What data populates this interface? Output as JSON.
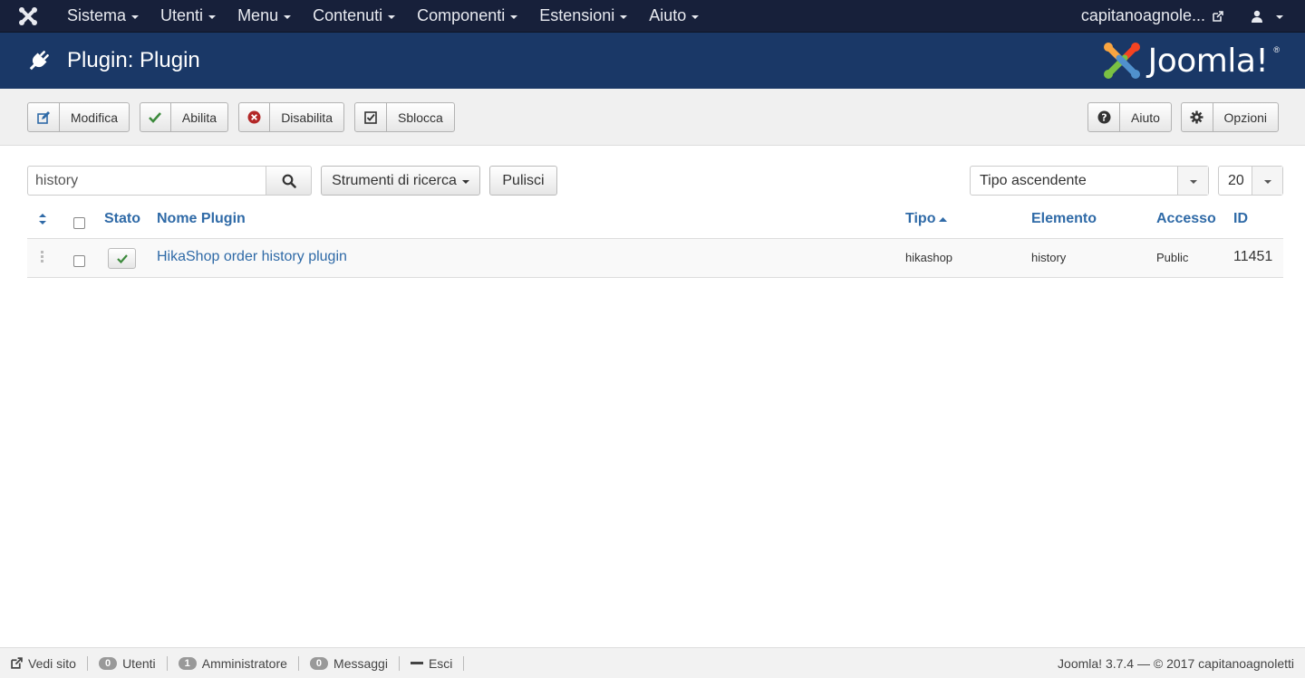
{
  "navbar": {
    "menus": [
      {
        "label": "Sistema"
      },
      {
        "label": "Utenti"
      },
      {
        "label": "Menu"
      },
      {
        "label": "Contenuti"
      },
      {
        "label": "Componenti"
      },
      {
        "label": "Estensioni"
      },
      {
        "label": "Aiuto"
      }
    ],
    "site_name": "capitanoagnole..."
  },
  "header": {
    "title": "Plugin: Plugin",
    "brand": "Joomla!",
    "brand_reg": "®"
  },
  "toolbar": {
    "edit_label": "Modifica",
    "enable_label": "Abilita",
    "disable_label": "Disabilita",
    "unlock_label": "Sblocca",
    "help_label": "Aiuto",
    "options_label": "Opzioni"
  },
  "filters": {
    "search_value": "history",
    "search_tools_label": "Strumenti di ricerca",
    "clear_label": "Pulisci",
    "ordering_value": "Tipo ascendente",
    "limit_value": "20"
  },
  "table": {
    "headers": {
      "status": "Stato",
      "name": "Nome Plugin",
      "type": "Tipo",
      "element": "Elemento",
      "access": "Accesso",
      "id": "ID"
    },
    "rows": [
      {
        "name": "HikaShop order history plugin",
        "type": "hikashop",
        "element": "history",
        "access": "Public",
        "id": "11451"
      }
    ]
  },
  "footer": {
    "view_site": "Vedi sito",
    "visitors_count": "0",
    "visitors_label": "Utenti",
    "admins_count": "1",
    "admins_label": "Amministratore",
    "messages_count": "0",
    "messages_label": "Messaggi",
    "logout_label": "Esci",
    "version": "Joomla! 3.7.4",
    "copyright": "— © 2017 capitanoagnoletti"
  },
  "colors": {
    "navbar_bg": "#17203a",
    "header_bg": "#1a3867",
    "link": "#2f6aa7",
    "enable_green": "#3c8a3c",
    "disable_red": "#b32828"
  }
}
